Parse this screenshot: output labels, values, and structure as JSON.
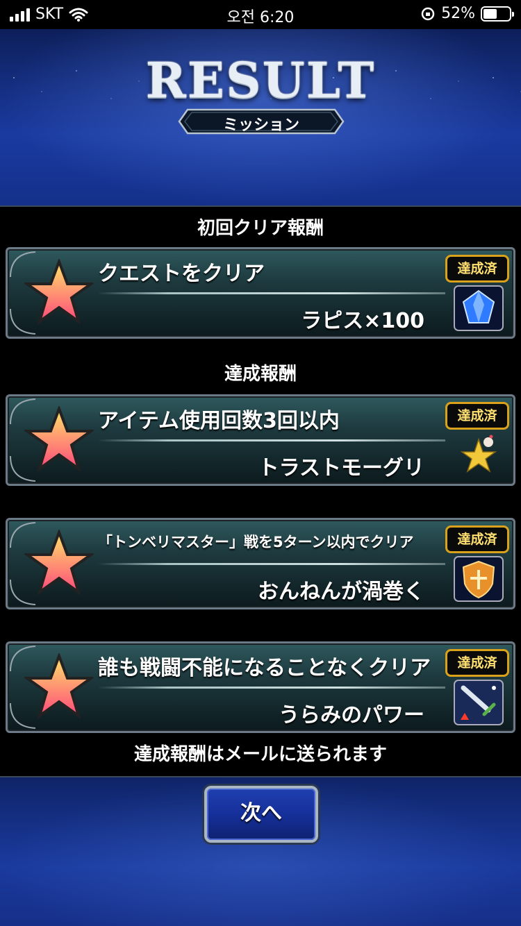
{
  "status_bar": {
    "carrier": "SKT",
    "time": "오전 6:20",
    "battery": "52%",
    "battery_level": 0.52
  },
  "header": {
    "title": "RESULT",
    "subtitle": "ミッション"
  },
  "sections": {
    "first_clear": "初回クリア報酬",
    "achievement": "達成報酬"
  },
  "missions": [
    {
      "title": "クエストをクリア",
      "reward": "ラピス×100",
      "badge": "達成済",
      "icon": "lapis-crystal-icon"
    },
    {
      "title": "アイテム使用回数3回以内",
      "reward": "トラストモーグリ",
      "badge": "達成済",
      "icon": "trust-moogle-icon"
    },
    {
      "title": "「トンベリマスター」戦を5ターン以内でクリア",
      "reward": "おんねんが渦巻く",
      "badge": "達成済",
      "icon": "shield-ability-icon"
    },
    {
      "title": "誰も戦闘不能になることなくクリア",
      "reward": "うらみのパワー",
      "badge": "達成済",
      "icon": "sword-attack-up-icon"
    }
  ],
  "footer_note": "達成報酬はメールに送られます",
  "next_button": "次へ",
  "colors": {
    "badge_border": "#d9a21a",
    "badge_text": "#ffe070",
    "button_blue": "#1f3fb0"
  }
}
